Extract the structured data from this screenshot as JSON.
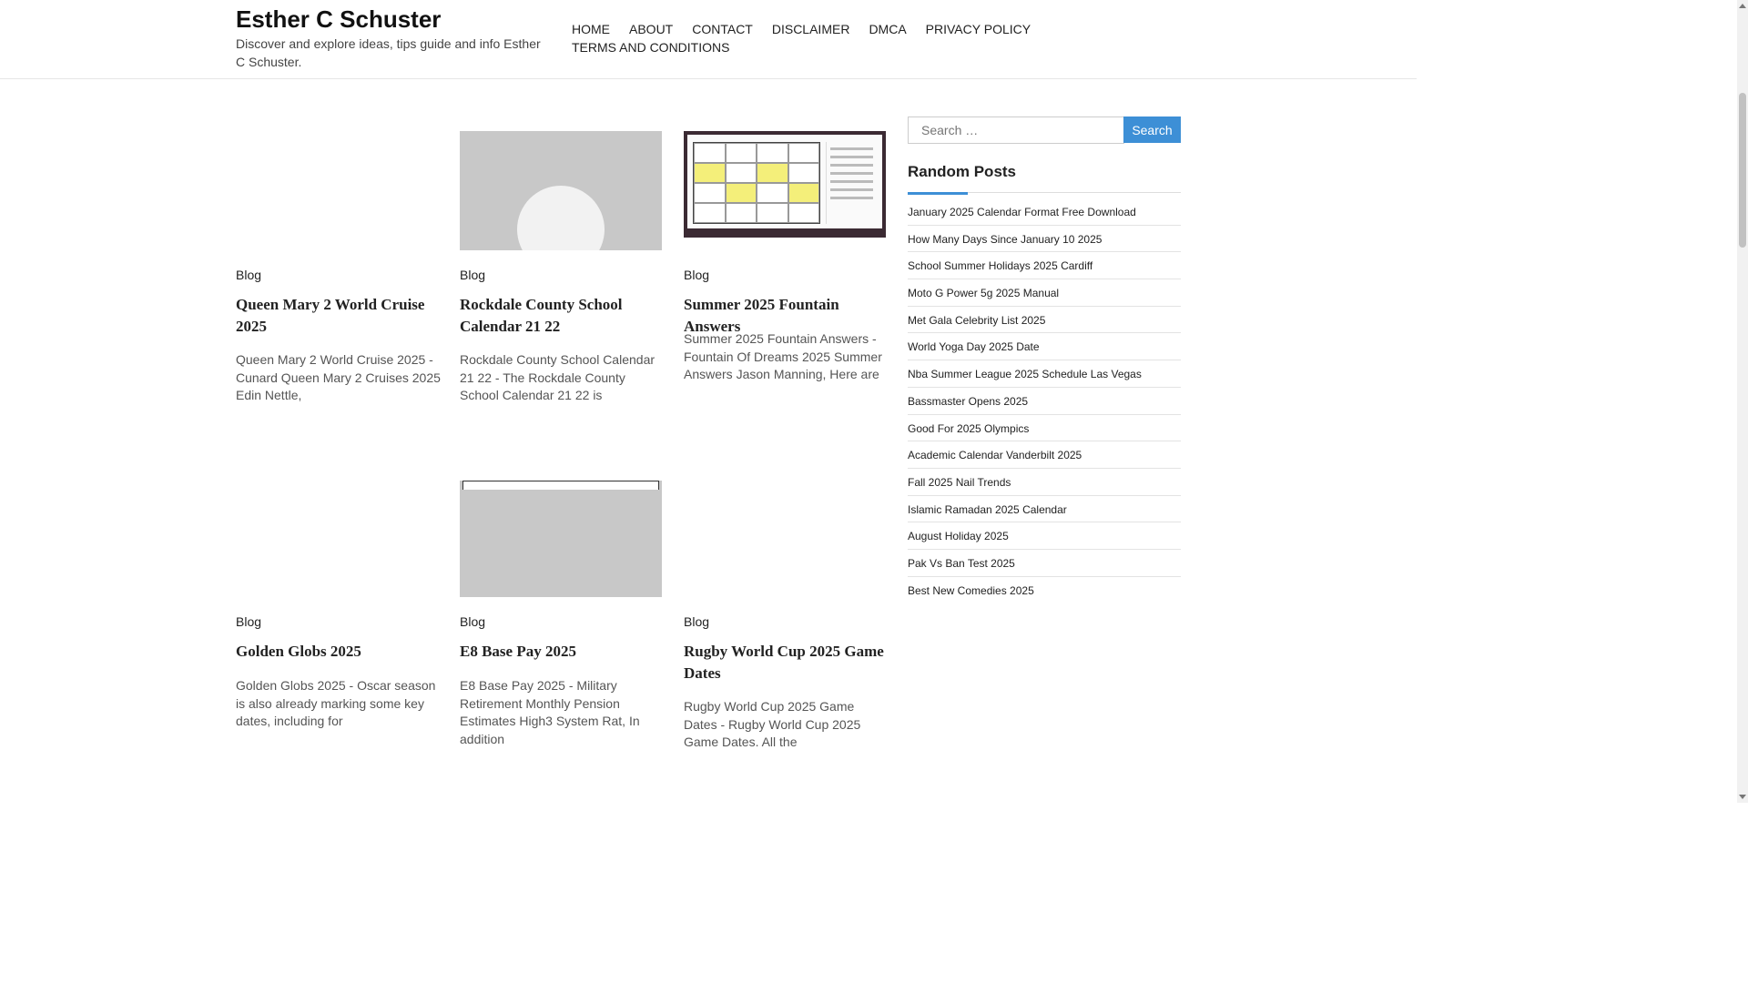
{
  "site": {
    "title": "Esther C Schuster",
    "description": "Discover and explore ideas, tips guide and info Esther C Schuster."
  },
  "nav": {
    "items": [
      "HOME",
      "ABOUT",
      "CONTACT",
      "DISCLAIMER",
      "DMCA",
      "PRIVACY POLICY",
      "TERMS AND CONDITIONS"
    ]
  },
  "posts": [
    {
      "category": "Blog",
      "title": "Queen Mary 2 World Cruise 2025",
      "excerpt": "Queen Mary 2 World Cruise 2025 - Cunard Queen Mary 2 Cruises 2025 Edin Nettle,"
    },
    {
      "category": "Blog",
      "title": "Rockdale County School Calendar 21 22",
      "excerpt": "Rockdale County School Calendar 21 22 - The Rockdale County School Calendar 21 22 is"
    },
    {
      "category": "Blog",
      "title": "Summer 2025 Fountain Answers",
      "excerpt": "Summer 2025 Fountain Answers - Fountain Of Dreams 2025 Summer Answers Jason Manning, Here are"
    },
    {
      "category": "Blog",
      "title": "Golden Globs 2025",
      "excerpt": "Golden Globs 2025 - Oscar season is also already marking some key dates, including for"
    },
    {
      "category": "Blog",
      "title": "E8 Base Pay 2025",
      "excerpt": "E8 Base Pay 2025 - Military Retirement Monthly Pension Estimates High3 System Rat, In addition"
    },
    {
      "category": "Blog",
      "title": "Rugby World Cup 2025 Game Dates",
      "excerpt": "Rugby World Cup 2025 Game Dates - Rugby World Cup 2025 Game Dates. All the"
    }
  ],
  "sidebar": {
    "search": {
      "placeholder": "Search …",
      "button_label": "Search"
    },
    "random_posts": {
      "title": "Random Posts",
      "items": [
        "January 2025 Calendar Format Free Download",
        "How Many Days Since January 10 2025",
        "School Summer Holidays 2025 Cardiff",
        "Moto G Power 5g 2025 Manual",
        "Met Gala Celebrity List 2025",
        "World Yoga Day 2025 Date",
        "Nba Summer League 2025 Schedule Las Vegas",
        "Bassmaster Opens 2025",
        "Good For 2025 Olympics",
        "Academic Calendar Vanderbilt 2025",
        "Fall 2025 Nail Trends",
        "Islamic Ramadan 2025 Calendar",
        "August Holiday 2025",
        "Pak Vs Ban Test 2025",
        "Best New Comedies 2025"
      ]
    }
  },
  "colors": {
    "accent": "#3d8fd6",
    "thumb_placeholder": "#c8c8c8"
  }
}
